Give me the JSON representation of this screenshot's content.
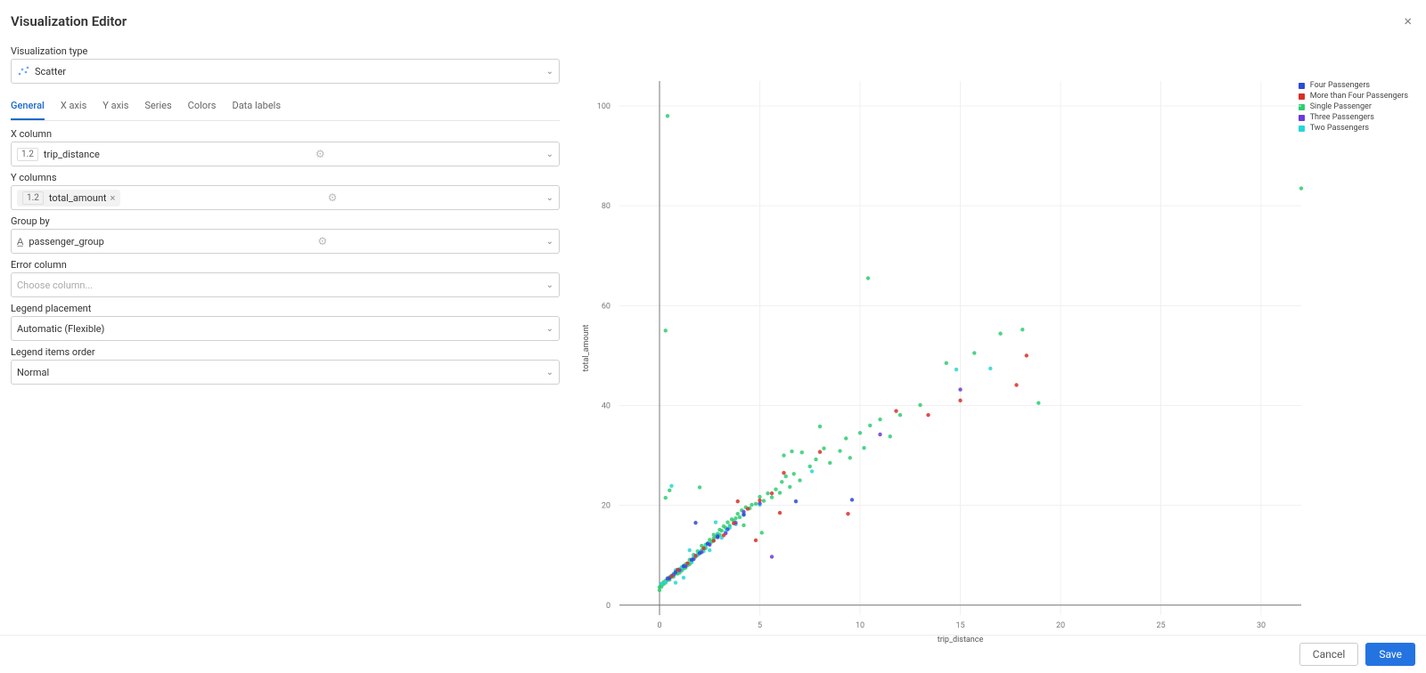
{
  "header": {
    "title": "Visualization Editor"
  },
  "form": {
    "type_label": "Visualization type",
    "type_value": "Scatter",
    "tabs": [
      "General",
      "X axis",
      "Y axis",
      "Series",
      "Colors",
      "Data labels"
    ],
    "active_tab": 0,
    "x_label": "X column",
    "x_prefix": "1.2",
    "x_value": "trip_distance",
    "y_label": "Y columns",
    "y_value": "total_amount",
    "group_label": "Group by",
    "group_value": "passenger_group",
    "err_label": "Error column",
    "err_placeholder": "Choose column...",
    "legend_label": "Legend placement",
    "legend_value": "Automatic (Flexible)",
    "order_label": "Legend items order",
    "order_value": "Normal"
  },
  "footer": {
    "cancel": "Cancel",
    "save": "Save"
  },
  "chart_data": {
    "type": "scatter",
    "xlabel": "trip_distance",
    "ylabel": "total_amount",
    "xlim": [
      -2,
      32
    ],
    "ylim": [
      -2,
      105
    ],
    "xticks": [
      0,
      5,
      10,
      15,
      20,
      25,
      30
    ],
    "yticks": [
      0,
      20,
      40,
      60,
      80,
      100
    ],
    "legend": [
      {
        "name": "Four Passengers",
        "color": "#2a4bd7"
      },
      {
        "name": "More than Four Passengers",
        "color": "#d73027"
      },
      {
        "name": "Single Passenger",
        "color": "#2ecc71"
      },
      {
        "name": "Three Passengers",
        "color": "#6a3bd8"
      },
      {
        "name": "Two Passengers",
        "color": "#29d6d6"
      }
    ],
    "series": {
      "Single Passenger": [
        [
          0,
          3
        ],
        [
          0,
          3.6
        ],
        [
          0.1,
          3.7
        ],
        [
          0.1,
          4.2
        ],
        [
          0.1,
          4.1
        ],
        [
          0.2,
          4.2
        ],
        [
          0.2,
          4.6
        ],
        [
          0.3,
          4.5
        ],
        [
          0.3,
          4.9
        ],
        [
          0.4,
          5
        ],
        [
          0.4,
          5.4
        ],
        [
          0.5,
          5.1
        ],
        [
          0.5,
          5.6
        ],
        [
          0.6,
          5.7
        ],
        [
          0.6,
          5.8
        ],
        [
          0.7,
          5.7
        ],
        [
          0.8,
          6.3
        ],
        [
          0.8,
          6.6
        ],
        [
          0.9,
          6.3
        ],
        [
          0.9,
          6.9
        ],
        [
          1,
          6.5
        ],
        [
          1,
          7.2
        ],
        [
          1.1,
          6.9
        ],
        [
          1.1,
          7.4
        ],
        [
          1.2,
          7.3
        ],
        [
          1.2,
          7.9
        ],
        [
          1.3,
          7.5
        ],
        [
          1.3,
          8.2
        ],
        [
          1.4,
          8
        ],
        [
          1.5,
          8.2
        ],
        [
          1.5,
          9.1
        ],
        [
          1.6,
          8.6
        ],
        [
          1.7,
          9.3
        ],
        [
          1.7,
          10.1
        ],
        [
          1.8,
          9.7
        ],
        [
          1.9,
          10.1
        ],
        [
          1.9,
          10.8
        ],
        [
          2,
          10.4
        ],
        [
          2.1,
          11
        ],
        [
          2.1,
          11.9
        ],
        [
          2.2,
          11.2
        ],
        [
          2.3,
          11.4
        ],
        [
          2.3,
          12.1
        ],
        [
          2.4,
          12.4
        ],
        [
          2.5,
          12.3
        ],
        [
          2.5,
          13.1
        ],
        [
          2.6,
          12.7
        ],
        [
          2.7,
          13.4
        ],
        [
          2.7,
          14.1
        ],
        [
          2.8,
          13.7
        ],
        [
          2.9,
          14.3
        ],
        [
          3,
          14.1
        ],
        [
          3,
          15.1
        ],
        [
          3.1,
          14.9
        ],
        [
          3.2,
          15.8
        ],
        [
          3.3,
          15.5
        ],
        [
          3.4,
          16.6
        ],
        [
          3.5,
          15.9
        ],
        [
          3.6,
          17.2
        ],
        [
          3.7,
          16.9
        ],
        [
          3.8,
          17.4
        ],
        [
          3.9,
          18.3
        ],
        [
          4,
          17.6
        ],
        [
          4.1,
          19
        ],
        [
          4.2,
          18.2
        ],
        [
          4.3,
          19.6
        ],
        [
          4.5,
          19.4
        ],
        [
          4.6,
          20.1
        ],
        [
          4.8,
          20.3
        ],
        [
          5,
          21.7
        ],
        [
          5.1,
          14.5
        ],
        [
          5.2,
          20.9
        ],
        [
          5.4,
          22.4
        ],
        [
          5.6,
          21.6
        ],
        [
          5.8,
          23.2
        ],
        [
          6,
          22.5
        ],
        [
          6.1,
          24.7
        ],
        [
          6.3,
          25.8
        ],
        [
          6.5,
          23.7
        ],
        [
          6.7,
          26.3
        ],
        [
          7,
          25
        ],
        [
          7.5,
          27.8
        ],
        [
          7.8,
          29.2
        ],
        [
          8,
          35.8
        ],
        [
          8.2,
          31.4
        ],
        [
          8.5,
          28.5
        ],
        [
          9,
          30.9
        ],
        [
          9.5,
          29.5
        ],
        [
          9.3,
          33.4
        ],
        [
          10,
          34.5
        ],
        [
          10.2,
          31.5
        ],
        [
          10.5,
          36
        ],
        [
          11,
          37.2
        ],
        [
          11.5,
          33.8
        ],
        [
          12,
          38.1
        ],
        [
          13,
          40.1
        ],
        [
          0.5,
          23
        ],
        [
          0.3,
          21.5
        ],
        [
          2,
          23.6
        ],
        [
          4.2,
          16
        ],
        [
          6.2,
          30
        ],
        [
          6.6,
          30.8
        ],
        [
          7.1,
          30.6
        ],
        [
          10.4,
          65.5
        ],
        [
          0.4,
          98
        ],
        [
          0.3,
          55
        ],
        [
          14.3,
          48.5
        ],
        [
          15.7,
          50.5
        ],
        [
          17,
          54.4
        ],
        [
          18.1,
          55.2
        ],
        [
          18.9,
          40.5
        ],
        [
          32,
          83.5
        ]
      ],
      "Two Passengers": [
        [
          0.1,
          4.3
        ],
        [
          0.3,
          4.6
        ],
        [
          0.4,
          5.4
        ],
        [
          0.6,
          5.9
        ],
        [
          0.7,
          6.3
        ],
        [
          0.8,
          7
        ],
        [
          1,
          6.9
        ],
        [
          1.1,
          7.6
        ],
        [
          1.3,
          7.9
        ],
        [
          1.4,
          8.3
        ],
        [
          1.6,
          8.7
        ],
        [
          1.7,
          9.7
        ],
        [
          1.9,
          10
        ],
        [
          2,
          10.6
        ],
        [
          2.2,
          10.8
        ],
        [
          2.3,
          11.8
        ],
        [
          2.5,
          11
        ],
        [
          2.7,
          13
        ],
        [
          2.9,
          14.1
        ],
        [
          3.1,
          13.5
        ],
        [
          3.3,
          14.7
        ],
        [
          3.5,
          15.5
        ],
        [
          3.8,
          16.2
        ],
        [
          0.8,
          4.5
        ],
        [
          1.2,
          5.5
        ],
        [
          1.5,
          11
        ],
        [
          2.8,
          16.6
        ],
        [
          0.6,
          23.9
        ],
        [
          4.2,
          18.2
        ],
        [
          5,
          20.1
        ],
        [
          7.6,
          26.8
        ],
        [
          14.8,
          47.2
        ],
        [
          16.5,
          47.4
        ]
      ],
      "Three Passengers": [
        [
          0.4,
          5.3
        ],
        [
          0.7,
          6.1
        ],
        [
          1,
          7
        ],
        [
          1.3,
          7.8
        ],
        [
          1.7,
          9.2
        ],
        [
          2.1,
          10.6
        ],
        [
          2.5,
          12.1
        ],
        [
          2.9,
          13.6
        ],
        [
          3.3,
          14.4
        ],
        [
          3.8,
          16.5
        ],
        [
          4.2,
          18.7
        ],
        [
          5,
          20.4
        ],
        [
          5.6,
          9.7
        ],
        [
          11,
          34.2
        ],
        [
          15,
          43.2
        ]
      ],
      "Four Passengers": [
        [
          0.5,
          5.4
        ],
        [
          0.8,
          6.6
        ],
        [
          1.2,
          7.8
        ],
        [
          1.6,
          9.1
        ],
        [
          2,
          10.4
        ],
        [
          2.4,
          12.3
        ],
        [
          2.9,
          13.8
        ],
        [
          3.4,
          15.2
        ],
        [
          4.2,
          18.1
        ],
        [
          1.8,
          16.5
        ],
        [
          6.8,
          20.8
        ],
        [
          9.6,
          21.1
        ]
      ],
      "More than Four Passengers": [
        [
          0.6,
          5.8
        ],
        [
          0.9,
          7.1
        ],
        [
          1.4,
          8.4
        ],
        [
          1.8,
          9.9
        ],
        [
          2.2,
          11.4
        ],
        [
          2.7,
          12.9
        ],
        [
          3.2,
          14
        ],
        [
          3.7,
          16.4
        ],
        [
          4.4,
          19.3
        ],
        [
          5,
          21
        ],
        [
          5.6,
          22.4
        ],
        [
          3.9,
          20.8
        ],
        [
          6,
          18.5
        ],
        [
          6.2,
          26.5
        ],
        [
          8,
          30.7
        ],
        [
          9.4,
          18.3
        ],
        [
          11.8,
          38.9
        ],
        [
          13.4,
          38.1
        ],
        [
          15,
          41
        ],
        [
          17.8,
          44.1
        ],
        [
          18.3,
          50
        ],
        [
          4.8,
          13
        ]
      ]
    }
  }
}
